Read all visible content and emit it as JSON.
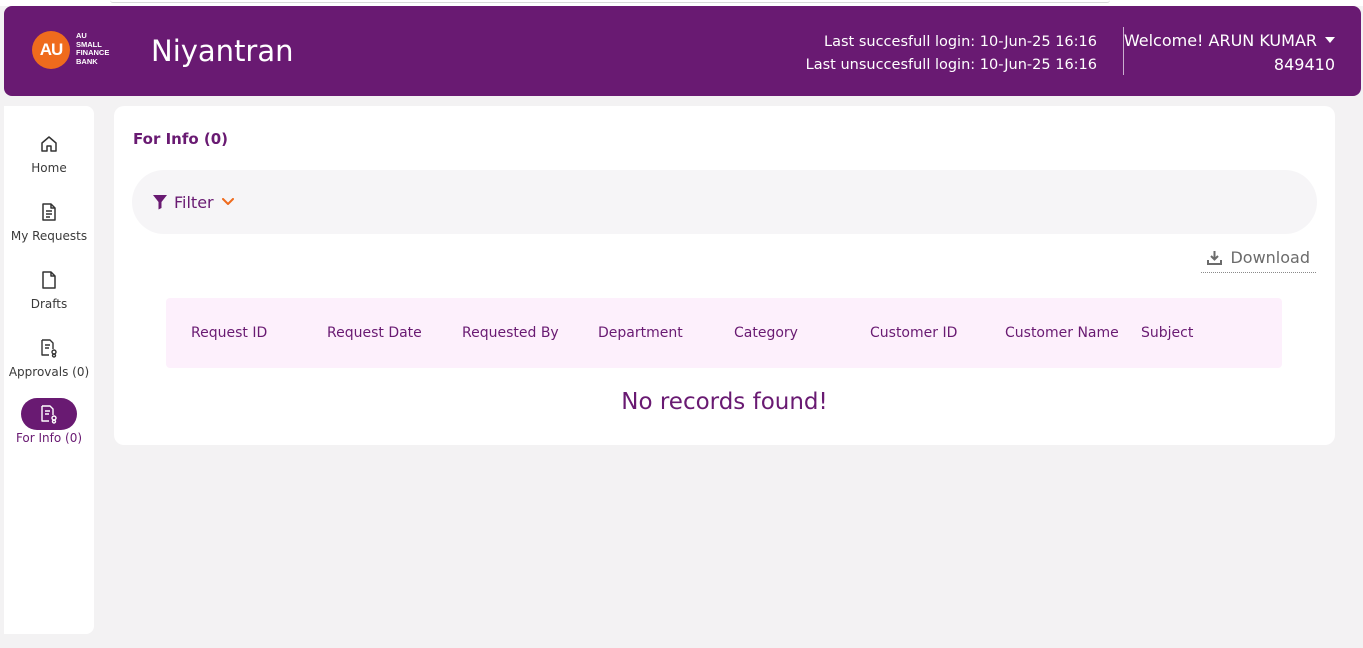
{
  "header": {
    "logo": {
      "mark": "AU",
      "lines": [
        "AU",
        "SMALL",
        "FINANCE",
        "BANK"
      ]
    },
    "app_title": "Niyantran",
    "last_successful_login": "Last succesfull login: 10-Jun-25 16:16",
    "last_unsuccessful_login": "Last unsuccesfull login: 10-Jun-25 16:16",
    "welcome_text": "Welcome! ARUN KUMAR",
    "user_id": "849410"
  },
  "sidebar": {
    "items": [
      {
        "label": "Home",
        "icon": "home-icon",
        "active": false
      },
      {
        "label": "My Requests",
        "icon": "document-icon",
        "active": false
      },
      {
        "label": "Drafts",
        "icon": "file-icon",
        "active": false
      },
      {
        "label": "Approvals (0)",
        "icon": "approvals-icon",
        "active": false
      },
      {
        "label": "For Info (0)",
        "icon": "info-document-icon",
        "active": true
      }
    ]
  },
  "main": {
    "title": "For Info (0)",
    "filter_label": "Filter",
    "download_label": "Download",
    "table": {
      "columns": [
        "Request ID",
        "Request Date",
        "Requested By",
        "Department",
        "Category",
        "Customer ID",
        "Customer Name",
        "Subject"
      ]
    },
    "empty_message": "No records found!"
  },
  "colors": {
    "brand_purple": "#691a72",
    "brand_orange": "#ef6b1d",
    "table_header_bg": "#fdf0fc"
  }
}
